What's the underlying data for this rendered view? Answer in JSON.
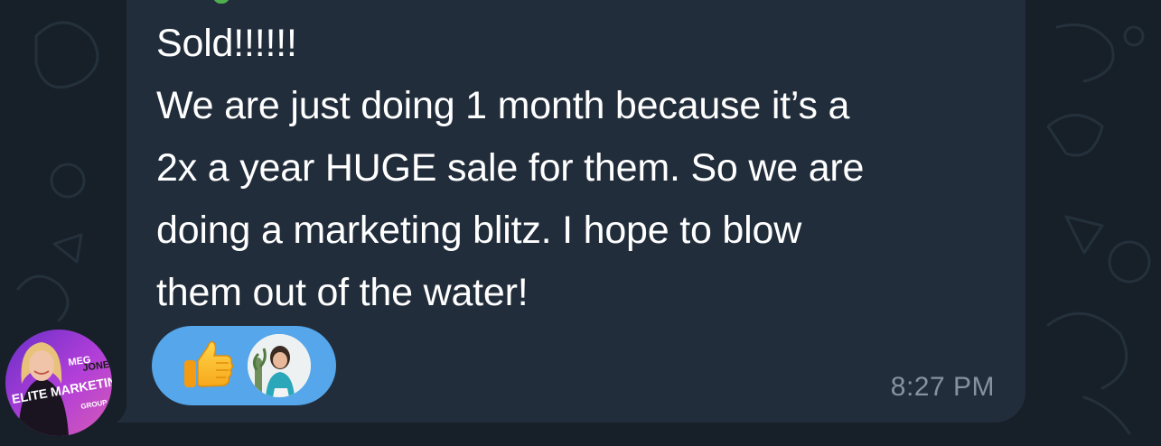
{
  "message": {
    "lines": [
      "Sold!!!!!!",
      "We are just doing 1 month because it’s a",
      "2x a year HUGE sale for them. So we are",
      "doing a marketing blitz. I hope to blow",
      "them out of the water!"
    ],
    "time": "8:27 PM"
  },
  "reactions": [
    {
      "type": "emoji",
      "icon": "thumbs-up-icon",
      "emoji": "👍"
    },
    {
      "type": "avatar",
      "icon": "reactor-avatar"
    }
  ],
  "sender_avatar": {
    "logo_line1": "MEG",
    "logo_line2": "JONES",
    "logo_line3": "ELITE MARKETING",
    "logo_line4": "GROUP"
  },
  "colors": {
    "background": "#172029",
    "bubble": "#212d3b",
    "reaction_pill": "#55a6ea",
    "text": "#ffffff",
    "timestamp": "#8592a0"
  }
}
